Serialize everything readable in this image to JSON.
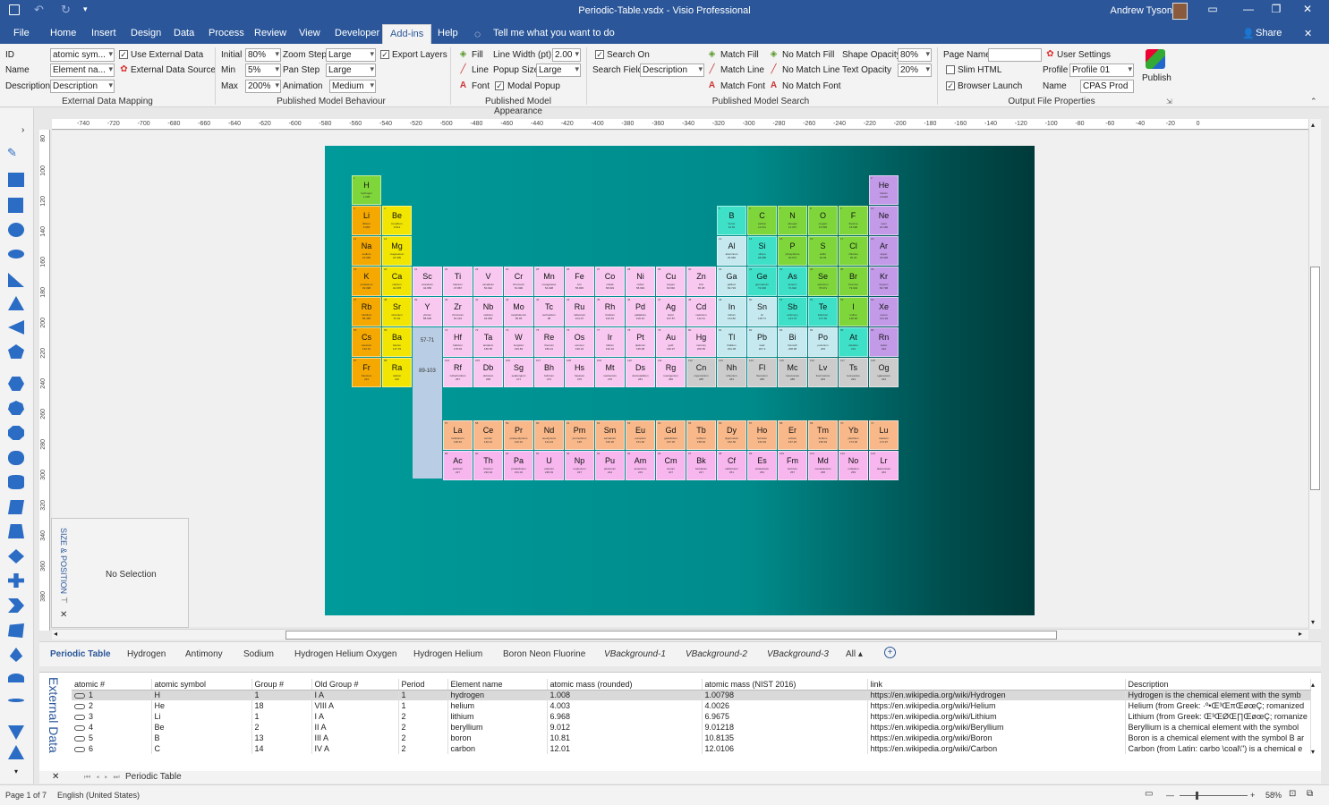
{
  "window": {
    "title": "Periodic-Table.vsdx  -  Visio Professional",
    "user": "Andrew Tyson"
  },
  "tabs": [
    "File",
    "Home",
    "Insert",
    "Design",
    "Data",
    "Process",
    "Review",
    "View",
    "Developer",
    "Add-ins",
    "Help"
  ],
  "active_tab": "Add-ins",
  "tell_me": "Tell me what you want to do",
  "share": "Share",
  "ribbon": {
    "mapping": {
      "id_label": "ID",
      "id_value": "atomic sym...",
      "name_label": "Name",
      "name_value": "Element na...",
      "desc_label": "Description",
      "desc_value": "Description",
      "use_external": "Use External Data",
      "external_source": "External Data Source",
      "group": "External Data Mapping"
    },
    "behaviour": {
      "initial_label": "Initial",
      "initial_value": "80%",
      "min_label": "Min",
      "min_value": "5%",
      "max_label": "Max",
      "max_value": "200%",
      "zoom_step_label": "Zoom Step",
      "zoom_step_value": "Large",
      "pan_step_label": "Pan Step",
      "pan_step_value": "Large",
      "animation_label": "Animation",
      "animation_value": "Medium",
      "export_layers": "Export Layers",
      "group": "Published Model Behaviour"
    },
    "appearance": {
      "fill": "Fill",
      "line": "Line",
      "font": "Font",
      "line_width_label": "Line Width (pt)",
      "line_width_value": "2.00",
      "popup_size_label": "Popup Size",
      "popup_size_value": "Large",
      "modal_popup": "Modal Popup",
      "group": "Published Model Appearance"
    },
    "search": {
      "search_on": "Search On",
      "search_field_label": "Search Field",
      "search_field_value": "Description",
      "match_fill": "Match Fill",
      "match_line": "Match Line",
      "match_font": "Match Font",
      "no_match_fill": "No Match Fill",
      "no_match_line": "No Match Line",
      "no_match_font": "No Match Font",
      "shape_opacity_label": "Shape Opacity",
      "shape_opacity_value": "80%",
      "text_opacity_label": "Text Opacity",
      "text_opacity_value": "20%",
      "group": "Published Model Search"
    },
    "output": {
      "page_name_label": "Page Name",
      "page_name_value": "",
      "slim_html": "Slim HTML",
      "browser_launch": "Browser Launch",
      "user_settings": "User Settings",
      "profile_label": "Profile",
      "profile_value": "Profile 01",
      "name_label": "Name",
      "name_value": "CPAS Prod",
      "publish": "Publish",
      "group": "Output File Properties"
    }
  },
  "hruler_ticks": [
    "-740",
    "-720",
    "-700",
    "-680",
    "-660",
    "-640",
    "-620",
    "-600",
    "-580",
    "-560",
    "-540",
    "-520",
    "-500",
    "-480",
    "-460",
    "-440",
    "-420",
    "-400",
    "-380",
    "-360",
    "-340",
    "-320",
    "-300",
    "-280",
    "-260",
    "-240",
    "-220",
    "-200",
    "-180",
    "-160",
    "-140",
    "-120",
    "-100",
    "-80",
    "-60",
    "-40",
    "-20",
    "0"
  ],
  "vruler_ticks": [
    "80",
    "100",
    "120",
    "140",
    "160",
    "180",
    "200",
    "220",
    "240",
    "260",
    "280",
    "300",
    "320",
    "340",
    "360",
    "380"
  ],
  "size_position": {
    "label": "SIZE & POSITION",
    "no_selection": "No Selection"
  },
  "placeholders": {
    "lanthanides": "57-71",
    "actinides": "89-103"
  },
  "elements": [
    {
      "s": "H",
      "n": "hydrogen",
      "m": "1.008",
      "z": 1,
      "c": "#7fd63a"
    },
    {
      "s": "He",
      "n": "helium",
      "m": "4.0026",
      "z": 2,
      "c": "#c39ae8"
    },
    {
      "s": "Li",
      "n": "lithium",
      "m": "6.968",
      "z": 3,
      "c": "#f5a800"
    },
    {
      "s": "Be",
      "n": "beryllium",
      "m": "9.012",
      "z": 4,
      "c": "#f2e600"
    },
    {
      "s": "B",
      "n": "boron",
      "m": "10.81",
      "z": 5,
      "c": "#3ee0c8"
    },
    {
      "s": "C",
      "n": "carbon",
      "m": "12.011",
      "z": 6,
      "c": "#7fd63a"
    },
    {
      "s": "N",
      "n": "nitrogen",
      "m": "14.007",
      "z": 7,
      "c": "#7fd63a"
    },
    {
      "s": "O",
      "n": "oxygen",
      "m": "15.999",
      "z": 8,
      "c": "#7fd63a"
    },
    {
      "s": "F",
      "n": "fluorine",
      "m": "18.998",
      "z": 9,
      "c": "#7fd63a"
    },
    {
      "s": "Ne",
      "n": "neon",
      "m": "20.180",
      "z": 10,
      "c": "#c39ae8"
    },
    {
      "s": "Na",
      "n": "sodium",
      "m": "22.990",
      "z": 11,
      "c": "#f5a800"
    },
    {
      "s": "Mg",
      "n": "magnesium",
      "m": "24.305",
      "z": 12,
      "c": "#f2e600"
    },
    {
      "s": "Al",
      "n": "aluminium",
      "m": "26.982",
      "z": 13,
      "c": "#c6e9f0"
    },
    {
      "s": "Si",
      "n": "silicon",
      "m": "28.085",
      "z": 14,
      "c": "#3ee0c8"
    },
    {
      "s": "P",
      "n": "phosphorus",
      "m": "30.974",
      "z": 15,
      "c": "#7fd63a"
    },
    {
      "s": "S",
      "n": "sulfur",
      "m": "32.06",
      "z": 16,
      "c": "#7fd63a"
    },
    {
      "s": "Cl",
      "n": "chlorine",
      "m": "35.45",
      "z": 17,
      "c": "#7fd63a"
    },
    {
      "s": "Ar",
      "n": "argon",
      "m": "39.948",
      "z": 18,
      "c": "#c39ae8"
    },
    {
      "s": "K",
      "n": "potassium",
      "m": "39.098",
      "z": 19,
      "c": "#f5a800"
    },
    {
      "s": "Ca",
      "n": "calcium",
      "m": "40.078",
      "z": 20,
      "c": "#f2e600"
    },
    {
      "s": "Sc",
      "n": "scandium",
      "m": "44.956",
      "z": 21,
      "c": "#f8c8f0"
    },
    {
      "s": "Ti",
      "n": "titanium",
      "m": "47.867",
      "z": 22,
      "c": "#f8c8f0"
    },
    {
      "s": "V",
      "n": "vanadium",
      "m": "50.942",
      "z": 23,
      "c": "#f8c8f0"
    },
    {
      "s": "Cr",
      "n": "chromium",
      "m": "51.996",
      "z": 24,
      "c": "#f8c8f0"
    },
    {
      "s": "Mn",
      "n": "manganese",
      "m": "54.938",
      "z": 25,
      "c": "#f8c8f0"
    },
    {
      "s": "Fe",
      "n": "iron",
      "m": "55.845",
      "z": 26,
      "c": "#f8c8f0"
    },
    {
      "s": "Co",
      "n": "cobalt",
      "m": "58.933",
      "z": 27,
      "c": "#f8c8f0"
    },
    {
      "s": "Ni",
      "n": "nickel",
      "m": "58.693",
      "z": 28,
      "c": "#f8c8f0"
    },
    {
      "s": "Cu",
      "n": "copper",
      "m": "63.546",
      "z": 29,
      "c": "#f8c8f0"
    },
    {
      "s": "Zn",
      "n": "zinc",
      "m": "65.38",
      "z": 30,
      "c": "#f8c8f0"
    },
    {
      "s": "Ga",
      "n": "gallium",
      "m": "69.723",
      "z": 31,
      "c": "#c6e9f0"
    },
    {
      "s": "Ge",
      "n": "germanium",
      "m": "72.630",
      "z": 32,
      "c": "#3ee0c8"
    },
    {
      "s": "As",
      "n": "arsenic",
      "m": "74.922",
      "z": 33,
      "c": "#3ee0c8"
    },
    {
      "s": "Se",
      "n": "selenium",
      "m": "78.971",
      "z": 34,
      "c": "#7fd63a"
    },
    {
      "s": "Br",
      "n": "bromine",
      "m": "79.904",
      "z": 35,
      "c": "#7fd63a"
    },
    {
      "s": "Kr",
      "n": "krypton",
      "m": "83.798",
      "z": 36,
      "c": "#c39ae8"
    },
    {
      "s": "Rb",
      "n": "rubidium",
      "m": "85.468",
      "z": 37,
      "c": "#f5a800"
    },
    {
      "s": "Sr",
      "n": "strontium",
      "m": "87.62",
      "z": 38,
      "c": "#f2e600"
    },
    {
      "s": "Y",
      "n": "yttrium",
      "m": "88.906",
      "z": 39,
      "c": "#f8c8f0"
    },
    {
      "s": "Zr",
      "n": "zirconium",
      "m": "91.224",
      "z": 40,
      "c": "#f8c8f0"
    },
    {
      "s": "Nb",
      "n": "niobium",
      "m": "92.906",
      "z": 41,
      "c": "#f8c8f0"
    },
    {
      "s": "Mo",
      "n": "molybdenum",
      "m": "95.95",
      "z": 42,
      "c": "#f8c8f0"
    },
    {
      "s": "Tc",
      "n": "technetium",
      "m": "98",
      "z": 43,
      "c": "#f8c8f0"
    },
    {
      "s": "Ru",
      "n": "ruthenium",
      "m": "101.07",
      "z": 44,
      "c": "#f8c8f0"
    },
    {
      "s": "Rh",
      "n": "rhodium",
      "m": "102.91",
      "z": 45,
      "c": "#f8c8f0"
    },
    {
      "s": "Pd",
      "n": "palladium",
      "m": "106.42",
      "z": 46,
      "c": "#f8c8f0"
    },
    {
      "s": "Ag",
      "n": "silver",
      "m": "107.87",
      "z": 47,
      "c": "#f8c8f0"
    },
    {
      "s": "Cd",
      "n": "cadmium",
      "m": "112.41",
      "z": 48,
      "c": "#f8c8f0"
    },
    {
      "s": "In",
      "n": "indium",
      "m": "114.82",
      "z": 49,
      "c": "#c6e9f0"
    },
    {
      "s": "Sn",
      "n": "tin",
      "m": "118.71",
      "z": 50,
      "c": "#c6e9f0"
    },
    {
      "s": "Sb",
      "n": "antimony",
      "m": "121.76",
      "z": 51,
      "c": "#3ee0c8"
    },
    {
      "s": "Te",
      "n": "tellurium",
      "m": "127.60",
      "z": 52,
      "c": "#3ee0c8"
    },
    {
      "s": "I",
      "n": "iodine",
      "m": "126.90",
      "z": 53,
      "c": "#7fd63a"
    },
    {
      "s": "Xe",
      "n": "xenon",
      "m": "131.29",
      "z": 54,
      "c": "#c39ae8"
    },
    {
      "s": "Cs",
      "n": "caesium",
      "m": "132.91",
      "z": 55,
      "c": "#f5a800"
    },
    {
      "s": "Ba",
      "n": "barium",
      "m": "137.33",
      "z": 56,
      "c": "#f2e600"
    },
    {
      "s": "Hf",
      "n": "hafnium",
      "m": "178.49",
      "z": 72,
      "c": "#f8c8f0"
    },
    {
      "s": "Ta",
      "n": "tantalum",
      "m": "180.95",
      "z": 73,
      "c": "#f8c8f0"
    },
    {
      "s": "W",
      "n": "tungsten",
      "m": "183.84",
      "z": 74,
      "c": "#f8c8f0"
    },
    {
      "s": "Re",
      "n": "rhenium",
      "m": "186.21",
      "z": 75,
      "c": "#f8c8f0"
    },
    {
      "s": "Os",
      "n": "osmium",
      "m": "190.23",
      "z": 76,
      "c": "#f8c8f0"
    },
    {
      "s": "Ir",
      "n": "iridium",
      "m": "192.22",
      "z": 77,
      "c": "#f8c8f0"
    },
    {
      "s": "Pt",
      "n": "platinum",
      "m": "195.08",
      "z": 78,
      "c": "#f8c8f0"
    },
    {
      "s": "Au",
      "n": "gold",
      "m": "196.97",
      "z": 79,
      "c": "#f8c8f0"
    },
    {
      "s": "Hg",
      "n": "mercury",
      "m": "200.59",
      "z": 80,
      "c": "#f8c8f0"
    },
    {
      "s": "Tl",
      "n": "thallium",
      "m": "204.38",
      "z": 81,
      "c": "#c6e9f0"
    },
    {
      "s": "Pb",
      "n": "lead",
      "m": "207.2",
      "z": 82,
      "c": "#c6e9f0"
    },
    {
      "s": "Bi",
      "n": "bismuth",
      "m": "208.98",
      "z": 83,
      "c": "#c6e9f0"
    },
    {
      "s": "Po",
      "n": "polonium",
      "m": "209",
      "z": 84,
      "c": "#c6e9f0"
    },
    {
      "s": "At",
      "n": "astatine",
      "m": "210",
      "z": 85,
      "c": "#3ee0c8"
    },
    {
      "s": "Rn",
      "n": "radon",
      "m": "222",
      "z": 86,
      "c": "#c39ae8"
    },
    {
      "s": "Fr",
      "n": "francium",
      "m": "223",
      "z": 87,
      "c": "#f5a800"
    },
    {
      "s": "Ra",
      "n": "radium",
      "m": "226",
      "z": 88,
      "c": "#f2e600"
    },
    {
      "s": "Rf",
      "n": "rutherfordium",
      "m": "267",
      "z": 104,
      "c": "#f8c8f0"
    },
    {
      "s": "Db",
      "n": "dubnium",
      "m": "268",
      "z": 105,
      "c": "#f8c8f0"
    },
    {
      "s": "Sg",
      "n": "seaborgium",
      "m": "271",
      "z": 106,
      "c": "#f8c8f0"
    },
    {
      "s": "Bh",
      "n": "bohrium",
      "m": "272",
      "z": 107,
      "c": "#f8c8f0"
    },
    {
      "s": "Hs",
      "n": "hassium",
      "m": "270",
      "z": 108,
      "c": "#f8c8f0"
    },
    {
      "s": "Mt",
      "n": "meitnerium",
      "m": "276",
      "z": 109,
      "c": "#f8c8f0"
    },
    {
      "s": "Ds",
      "n": "darmstadtium",
      "m": "281",
      "z": 110,
      "c": "#f8c8f0"
    },
    {
      "s": "Rg",
      "n": "roentgenium",
      "m": "280",
      "z": 111,
      "c": "#f8c8f0"
    },
    {
      "s": "Cn",
      "n": "copernicium",
      "m": "285",
      "z": 112,
      "c": "#cccccc"
    },
    {
      "s": "Nh",
      "n": "nihonium",
      "m": "284",
      "z": 113,
      "c": "#cccccc"
    },
    {
      "s": "Fl",
      "n": "flerovium",
      "m": "289",
      "z": 114,
      "c": "#cccccc"
    },
    {
      "s": "Mc",
      "n": "moscovium",
      "m": "288",
      "z": 115,
      "c": "#cccccc"
    },
    {
      "s": "Lv",
      "n": "livermorium",
      "m": "293",
      "z": 116,
      "c": "#cccccc"
    },
    {
      "s": "Ts",
      "n": "tennessine",
      "m": "294",
      "z": 117,
      "c": "#cccccc"
    },
    {
      "s": "Og",
      "n": "oganesson",
      "m": "294",
      "z": 118,
      "c": "#cccccc"
    },
    {
      "s": "La",
      "n": "lanthanum",
      "m": "138.91",
      "z": 57,
      "c": "#f8b88a"
    },
    {
      "s": "Ce",
      "n": "cerium",
      "m": "140.12",
      "z": 58,
      "c": "#f8b88a"
    },
    {
      "s": "Pr",
      "n": "praseodymium",
      "m": "140.91",
      "z": 59,
      "c": "#f8b88a"
    },
    {
      "s": "Nd",
      "n": "neodymium",
      "m": "144.24",
      "z": 60,
      "c": "#f8b88a"
    },
    {
      "s": "Pm",
      "n": "promethium",
      "m": "145",
      "z": 61,
      "c": "#f8b88a"
    },
    {
      "s": "Sm",
      "n": "samarium",
      "m": "150.36",
      "z": 62,
      "c": "#f8b88a"
    },
    {
      "s": "Eu",
      "n": "europium",
      "m": "151.96",
      "z": 63,
      "c": "#f8b88a"
    },
    {
      "s": "Gd",
      "n": "gadolinium",
      "m": "157.25",
      "z": 64,
      "c": "#f8b88a"
    },
    {
      "s": "Tb",
      "n": "terbium",
      "m": "158.93",
      "z": 65,
      "c": "#f8b88a"
    },
    {
      "s": "Dy",
      "n": "dysprosium",
      "m": "162.50",
      "z": 66,
      "c": "#f8b88a"
    },
    {
      "s": "Ho",
      "n": "holmium",
      "m": "164.93",
      "z": 67,
      "c": "#f8b88a"
    },
    {
      "s": "Er",
      "n": "erbium",
      "m": "167.26",
      "z": 68,
      "c": "#f8b88a"
    },
    {
      "s": "Tm",
      "n": "thulium",
      "m": "168.93",
      "z": 69,
      "c": "#f8b88a"
    },
    {
      "s": "Yb",
      "n": "ytterbium",
      "m": "173.05",
      "z": 70,
      "c": "#f8b88a"
    },
    {
      "s": "Lu",
      "n": "lutetium",
      "m": "174.97",
      "z": 71,
      "c": "#f8b88a"
    },
    {
      "s": "Ac",
      "n": "actinium",
      "m": "227",
      "z": 89,
      "c": "#f7b6ee"
    },
    {
      "s": "Th",
      "n": "thorium",
      "m": "232.04",
      "z": 90,
      "c": "#f7b6ee"
    },
    {
      "s": "Pa",
      "n": "protactinium",
      "m": "231.04",
      "z": 91,
      "c": "#f7b6ee"
    },
    {
      "s": "U",
      "n": "uranium",
      "m": "238.03",
      "z": 92,
      "c": "#f7b6ee"
    },
    {
      "s": "Np",
      "n": "neptunium",
      "m": "237",
      "z": 93,
      "c": "#f7b6ee"
    },
    {
      "s": "Pu",
      "n": "plutonium",
      "m": "244",
      "z": 94,
      "c": "#f7b6ee"
    },
    {
      "s": "Am",
      "n": "americium",
      "m": "243",
      "z": 95,
      "c": "#f7b6ee"
    },
    {
      "s": "Cm",
      "n": "curium",
      "m": "247",
      "z": 96,
      "c": "#f7b6ee"
    },
    {
      "s": "Bk",
      "n": "berkelium",
      "m": "247",
      "z": 97,
      "c": "#f7b6ee"
    },
    {
      "s": "Cf",
      "n": "californium",
      "m": "251",
      "z": 98,
      "c": "#f7b6ee"
    },
    {
      "s": "Es",
      "n": "einsteinium",
      "m": "252",
      "z": 99,
      "c": "#f7b6ee"
    },
    {
      "s": "Fm",
      "n": "fermium",
      "m": "257",
      "z": 100,
      "c": "#f7b6ee"
    },
    {
      "s": "Md",
      "n": "mendelevium",
      "m": "258",
      "z": 101,
      "c": "#f7b6ee"
    },
    {
      "s": "No",
      "n": "nobelium",
      "m": "259",
      "z": 102,
      "c": "#f7b6ee"
    },
    {
      "s": "Lr",
      "n": "lawrencium",
      "m": "262",
      "z": 103,
      "c": "#f7b6ee"
    }
  ],
  "page_tabs": [
    {
      "label": "Periodic Table",
      "style": "active"
    },
    {
      "label": "Hydrogen",
      "style": ""
    },
    {
      "label": "Antimony",
      "style": ""
    },
    {
      "label": "Sodium",
      "style": ""
    },
    {
      "label": "Hydrogen Helium Oxygen",
      "style": ""
    },
    {
      "label": "Hydrogen Helium",
      "style": ""
    },
    {
      "label": "Boron Neon Fluorine",
      "style": ""
    },
    {
      "label": "VBackground-1",
      "style": "it"
    },
    {
      "label": "VBackground-2",
      "style": "it"
    },
    {
      "label": "VBackground-3",
      "style": "it"
    },
    {
      "label": "All ▴",
      "style": ""
    }
  ],
  "external_data": {
    "label": "External Data",
    "tab": "Periodic Table",
    "columns": [
      "atomic #",
      "atomic symbol",
      "Group #",
      "Old Group #",
      "Period",
      "Element name",
      "atomic mass (rounded)",
      "atomic mass (NIST 2016)",
      "link",
      "Description"
    ],
    "rows": [
      [
        "1",
        "H",
        "1",
        "I A",
        "1",
        "hydrogen",
        "1.008",
        "1.00798",
        "https://en.wikipedia.org/wiki/Hydrogen",
        "Hydrogen is the chemical element with the symb"
      ],
      [
        "2",
        "He",
        "18",
        "VIII A",
        "1",
        "helium",
        "4.003",
        "4.0026",
        "https://en.wikipedia.org/wiki/Helium",
        "Helium (from Greek: ·º•Œ³ŒπŒøœÇ; romanized"
      ],
      [
        "3",
        "Li",
        "1",
        "I A",
        "2",
        "lithium",
        "6.968",
        "6.9675",
        "https://en.wikipedia.org/wiki/Lithium",
        "Lithium (from Greek: Œ³ŒØŒ∏ŒøœÇ; romanize"
      ],
      [
        "4",
        "Be",
        "2",
        "II A",
        "2",
        "beryllium",
        "9.012",
        "9.01218",
        "https://en.wikipedia.org/wiki/Beryllium",
        "Beryllium is a chemical element with the symbol"
      ],
      [
        "5",
        "B",
        "13",
        "III A",
        "2",
        "boron",
        "10.81",
        "10.8135",
        "https://en.wikipedia.org/wiki/Boron",
        "Boron is a chemical element with the symbol B ar"
      ],
      [
        "6",
        "C",
        "14",
        "IV A",
        "2",
        "carbon",
        "12.01",
        "12.0106",
        "https://en.wikipedia.org/wiki/Carbon",
        "Carbon (from Latin: carbo \\coal\\\") is a chemical e"
      ]
    ]
  },
  "status": {
    "page": "Page 1 of 7",
    "language": "English (United States)",
    "zoom": "58%"
  }
}
